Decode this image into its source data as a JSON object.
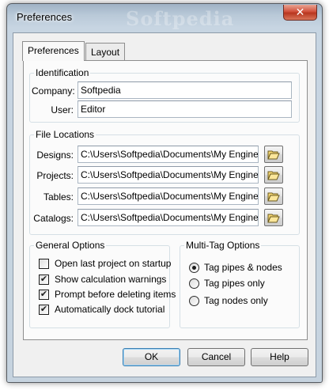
{
  "window": {
    "title": "Preferences",
    "watermark": "Softpedia",
    "close_glyph": "✕"
  },
  "tabs": [
    {
      "label": "Preferences",
      "active": true
    },
    {
      "label": "Layout",
      "active": false
    }
  ],
  "identification": {
    "legend": "Identification",
    "company_label": "Company:",
    "company_value": "Softpedia",
    "user_label": "User:",
    "user_value": "Editor"
  },
  "file_locations": {
    "legend": "File Locations",
    "rows": [
      {
        "label": "Designs:",
        "path": "C:\\Users\\Softpedia\\Documents\\My Engine",
        "icon": "folder-open-icon"
      },
      {
        "label": "Projects:",
        "path": "C:\\Users\\Softpedia\\Documents\\My Engine",
        "icon": "folder-open-icon"
      },
      {
        "label": "Tables:",
        "path": "C:\\Users\\Softpedia\\Documents\\My Engine",
        "icon": "folder-open-icon"
      },
      {
        "label": "Catalogs:",
        "path": "C:\\Users\\Softpedia\\Documents\\My Engine",
        "icon": "folder-open-icon"
      }
    ]
  },
  "general_options": {
    "legend": "General Options",
    "items": [
      {
        "label": "Open last project on startup",
        "checked": false
      },
      {
        "label": "Show calculation warnings",
        "checked": true
      },
      {
        "label": "Prompt before deleting items",
        "checked": true
      },
      {
        "label": "Automatically dock tutorial",
        "checked": true
      }
    ]
  },
  "multi_tag_options": {
    "legend": "Multi-Tag Options",
    "items": [
      {
        "label": "Tag pipes & nodes",
        "selected": true
      },
      {
        "label": "Tag pipes only",
        "selected": false
      },
      {
        "label": "Tag nodes only",
        "selected": false
      }
    ]
  },
  "buttons": {
    "ok": "OK",
    "cancel": "Cancel",
    "help": "Help"
  },
  "check_glyph": "✔"
}
